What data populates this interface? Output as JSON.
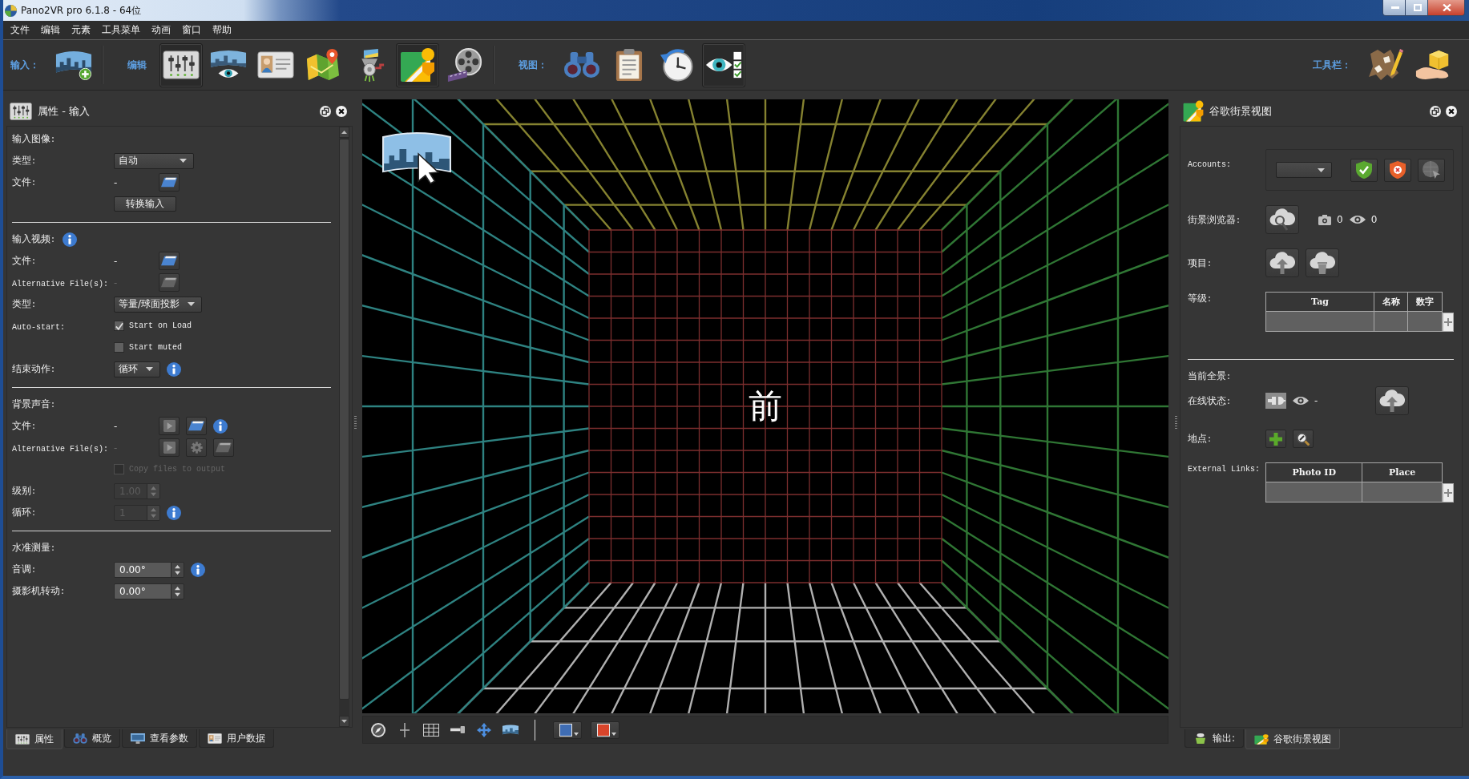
{
  "window": {
    "title": "Pano2VR pro 6.1.8 - 64位"
  },
  "menu": [
    "文件",
    "编辑",
    "元素",
    "工具菜单",
    "动画",
    "窗口",
    "帮助"
  ],
  "toolbar": {
    "groups": [
      {
        "label": "输入：",
        "tools": [
          {
            "kind": "panorama-add",
            "selected": false
          }
        ]
      },
      {
        "label": "编辑",
        "tools": [
          {
            "kind": "mixer",
            "selected": true
          },
          {
            "kind": "panorama-eye",
            "selected": false
          },
          {
            "kind": "id-card",
            "selected": false
          },
          {
            "kind": "map-pin",
            "selected": false
          },
          {
            "kind": "grinder",
            "selected": false
          },
          {
            "kind": "map-person",
            "selected": true
          },
          {
            "kind": "film-reel",
            "selected": false
          }
        ]
      },
      {
        "label": "视图：",
        "tools": [
          {
            "kind": "binoculars",
            "selected": false
          },
          {
            "kind": "clipboard",
            "selected": false
          },
          {
            "kind": "stopwatch",
            "selected": false
          },
          {
            "kind": "eye-checklist",
            "selected": true
          }
        ]
      }
    ],
    "end_group": {
      "label": "工具栏：",
      "tools": [
        {
          "kind": "map-pencil",
          "selected": false
        },
        {
          "kind": "hand-box",
          "selected": false
        }
      ]
    }
  },
  "properties_panel": {
    "title": "属性 - 输入",
    "sections": [
      {
        "title": "输入图像:",
        "info": false,
        "rows": [
          {
            "label": "类型:",
            "controls": [
              {
                "kind": "dropdown",
                "value": "自动"
              }
            ]
          },
          {
            "label": "文件:",
            "controls": [
              {
                "kind": "value",
                "text": "-",
                "disabled": false
              },
              {
                "kind": "folder-button",
                "disabled": false
              }
            ]
          },
          {
            "controls": [
              {
                "kind": "button",
                "text": "转换输入"
              }
            ]
          }
        ]
      },
      {
        "title": "输入视频:",
        "info": true,
        "rows": [
          {
            "label": "文件:",
            "controls": [
              {
                "kind": "value",
                "text": "-",
                "disabled": false
              },
              {
                "kind": "folder-button",
                "disabled": false
              }
            ]
          },
          {
            "label": "Alternative File(s):",
            "controls": [
              {
                "kind": "value",
                "text": "-",
                "disabled": true
              },
              {
                "kind": "folder-button",
                "disabled": true
              }
            ]
          },
          {
            "label": "类型:",
            "controls": [
              {
                "kind": "dropdown",
                "value": "等量/球面投影"
              }
            ]
          },
          {
            "label": "Auto-start:",
            "controls": [
              {
                "kind": "checkbox",
                "text": "Start on Load",
                "checked": true,
                "disabled": false
              }
            ]
          },
          {
            "controls": [
              {
                "kind": "checkbox",
                "text": "Start muted",
                "checked": false,
                "disabled": false
              }
            ]
          },
          {
            "label": "结束动作:",
            "controls": [
              {
                "kind": "dropdown",
                "value": "循环"
              },
              {
                "kind": "info"
              }
            ]
          }
        ]
      },
      {
        "title": "背景声音:",
        "info": false,
        "rows": [
          {
            "label": "文件:",
            "controls": [
              {
                "kind": "value",
                "text": "-",
                "disabled": false
              },
              {
                "kind": "play-button",
                "disabled": true
              },
              {
                "kind": "folder-button",
                "disabled": false
              },
              {
                "kind": "info"
              }
            ]
          },
          {
            "label": "Alternative File(s):",
            "controls": [
              {
                "kind": "value",
                "text": "-",
                "disabled": true
              },
              {
                "kind": "play-button",
                "disabled": true
              },
              {
                "kind": "gear-button",
                "disabled": true
              },
              {
                "kind": "folder-button",
                "disabled": true
              }
            ]
          },
          {
            "controls": [
              {
                "kind": "checkbox",
                "text": "Copy files to output",
                "checked": false,
                "disabled": true
              }
            ]
          },
          {
            "label": "级别:",
            "controls": [
              {
                "kind": "spinbox",
                "value": "1.00",
                "disabled": true
              }
            ]
          },
          {
            "label": "循环:",
            "controls": [
              {
                "kind": "spinbox",
                "value": "1",
                "disabled": true
              },
              {
                "kind": "info"
              }
            ]
          }
        ]
      },
      {
        "title": "水准测量:",
        "info": false,
        "rows": [
          {
            "label": "音调:",
            "controls": [
              {
                "kind": "spinbox",
                "value": "0.00°",
                "disabled": false
              },
              {
                "kind": "info"
              }
            ]
          },
          {
            "label": "摄影机转动:",
            "controls": [
              {
                "kind": "spinbox",
                "value": "0.00°",
                "disabled": false
              }
            ]
          }
        ]
      }
    ],
    "tabs": [
      {
        "label": "属性",
        "kind": "mixer",
        "selected": true
      },
      {
        "label": "概览",
        "kind": "binoculars",
        "selected": false
      },
      {
        "label": "查看参数",
        "kind": "monitor",
        "selected": false
      },
      {
        "label": "用户数据",
        "kind": "id-card",
        "selected": false
      }
    ]
  },
  "viewport": {
    "face_label": "前",
    "toolbar": {
      "tools": [
        {
          "kind": "compass"
        },
        {
          "kind": "crosshair"
        },
        {
          "kind": "grid"
        },
        {
          "kind": "level"
        },
        {
          "kind": "move"
        },
        {
          "kind": "panorama"
        }
      ],
      "color_buttons": [
        {
          "color": "#3f6db4"
        },
        {
          "color": "#d8452b"
        }
      ]
    }
  },
  "street_view_panel": {
    "title": "谷歌街景视图",
    "sections": [
      {
        "rows": [
          {
            "label": "Accounts:",
            "controls": [
              {
                "kind": "group",
                "controls": [
                  {
                    "kind": "dropdown"
                  },
                  {
                    "kind": "shield-check-button",
                    "disabled": false
                  },
                  {
                    "kind": "shield-x-button",
                    "disabled": false
                  },
                  {
                    "kind": "globe-cursor-button",
                    "disabled": true
                  }
                ]
              }
            ]
          },
          {
            "label": "街景浏览器:",
            "controls": [
              {
                "kind": "cloud-search-button"
              },
              {
                "kind": "camera-counter",
                "text": "0"
              },
              {
                "kind": "eye-counter",
                "text": "0"
              }
            ]
          },
          {
            "label": "项目:",
            "controls": [
              {
                "kind": "cloud-upload-button"
              },
              {
                "kind": "cloud-trash-button"
              }
            ]
          },
          {
            "label": "等级:",
            "controls": [
              {
                "kind": "table",
                "columns": [
                  "Tag",
                  "名称",
                  "数字"
                ]
              }
            ]
          }
        ]
      },
      {
        "title": "当前全景:",
        "rows": [
          {
            "label": "在线状态:",
            "controls": [
              {
                "kind": "plug-status"
              },
              {
                "kind": "eye-counter",
                "text": "-"
              },
              {
                "kind": "cloud-upload-button"
              }
            ]
          },
          {
            "label": "地点:",
            "controls": [
              {
                "kind": "plus-button",
                "disabled": false
              },
              {
                "kind": "magnifier-button",
                "disabled": false
              }
            ]
          },
          {
            "label": "External Links:",
            "controls": [
              {
                "kind": "table",
                "columns": [
                  "Photo ID",
                  "Place"
                ]
              }
            ]
          }
        ]
      }
    ],
    "tabs": [
      {
        "label": "输出:",
        "kind": "figurine",
        "selected": false
      },
      {
        "label": "谷歌街景视图",
        "kind": "map-person",
        "selected": true
      }
    ]
  }
}
